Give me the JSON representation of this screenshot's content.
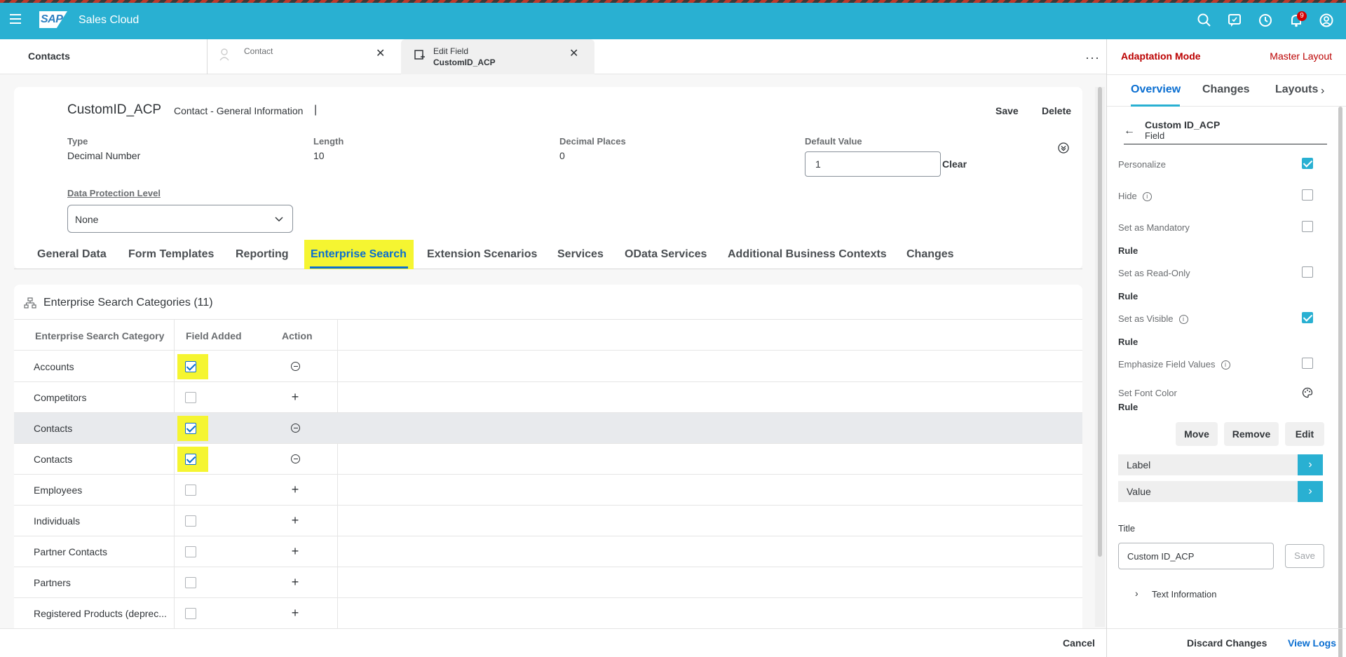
{
  "shell": {
    "logo": "SAP",
    "app_title": "Sales Cloud",
    "notification_count": "9",
    "accent": "#29b0d2"
  },
  "tabs": {
    "contacts": "Contacts",
    "contact": "Contact",
    "edit_field_line1": "Edit Field",
    "edit_field_line2": "CustomID_ACP"
  },
  "header": {
    "title": "CustomID_ACP",
    "subtitle": "Contact - General Information",
    "separator": "|",
    "save": "Save",
    "delete": "Delete",
    "fields": [
      {
        "label": "Type",
        "value": "Decimal Number"
      },
      {
        "label": "Length",
        "value": "10"
      },
      {
        "label": "Decimal Places",
        "value": "0"
      },
      {
        "label": "Default Value",
        "value": "1"
      }
    ],
    "clear": "Clear",
    "dpl_label": "Data Protection Level",
    "dpl_value": "None"
  },
  "nav_tabs": [
    "General Data",
    "Form Templates",
    "Reporting",
    "Enterprise Search",
    "Extension Scenarios",
    "Services",
    "OData Services",
    "Additional Business Contexts",
    "Changes"
  ],
  "active_tab": "Enterprise Search",
  "table": {
    "title": "Enterprise Search Categories  (11)",
    "columns": [
      "Enterprise Search Category",
      "Field Added",
      "Action"
    ],
    "rows": [
      {
        "name": "Accounts",
        "added": true,
        "highlight": true
      },
      {
        "name": "Competitors",
        "added": false
      },
      {
        "name": "Contacts",
        "added": true,
        "highlight": true,
        "selected": true
      },
      {
        "name": "Contacts",
        "added": true,
        "highlight": true
      },
      {
        "name": "Employees",
        "added": false
      },
      {
        "name": "Individuals",
        "added": false
      },
      {
        "name": "Partner Contacts",
        "added": false
      },
      {
        "name": "Partners",
        "added": false
      },
      {
        "name": "Registered Products (deprec...",
        "added": false
      }
    ]
  },
  "footer": {
    "cancel": "Cancel"
  },
  "panel": {
    "mode": "Adaptation Mode",
    "layout": "Master Layout",
    "tabs": [
      "Overview",
      "Changes",
      "Layouts"
    ],
    "field_name": "Custom ID_ACP",
    "field_type": "Field",
    "props": {
      "personalize": "Personalize",
      "hide": "Hide",
      "mandatory": "Set as Mandatory",
      "readonly": "Set as Read-Only",
      "visible": "Set as Visible",
      "emphasize": "Emphasize Field Values",
      "font_color": "Set Font Color",
      "rule": "Rule"
    },
    "buttons": {
      "move": "Move",
      "remove": "Remove",
      "edit": "Edit"
    },
    "label_row": "Label",
    "value_row": "Value",
    "title_label": "Title",
    "title_value": "Custom ID_ACP",
    "title_save": "Save",
    "text_info": "Text Information",
    "discard": "Discard Changes",
    "view_logs": "View Logs"
  }
}
